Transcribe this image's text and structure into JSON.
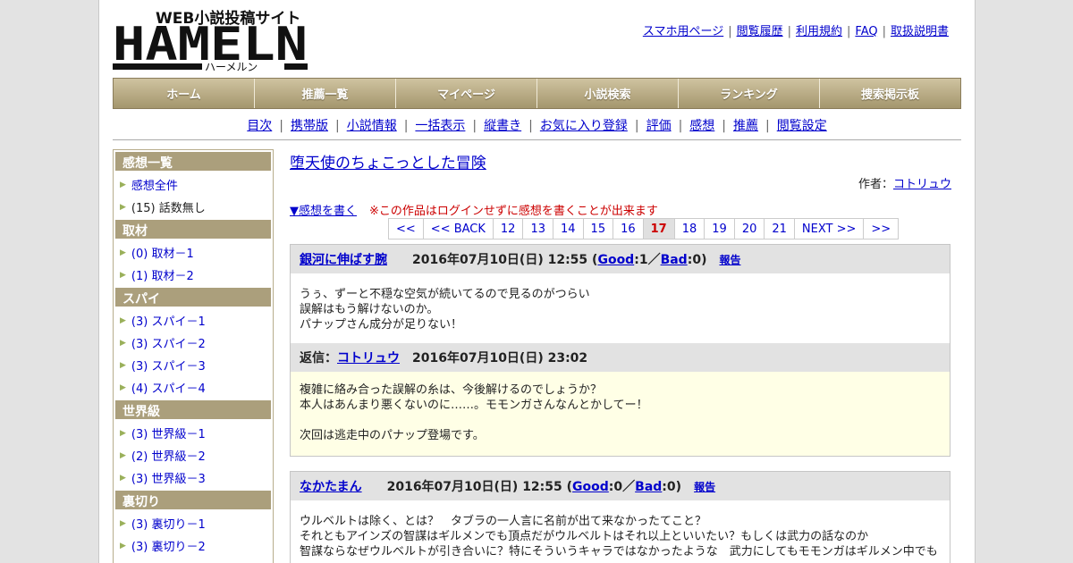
{
  "header": {
    "logo_tagline": "WEB小説投稿サイト",
    "logo_text": "HAMELN",
    "logo_kana": "ハーメルン",
    "toplinks": [
      "スマホ用ページ",
      "閲覧履歴",
      "利用規約",
      "FAQ",
      "取扱説明書"
    ]
  },
  "mainnav": [
    "ホーム",
    "推薦一覧",
    "マイページ",
    "小説検索",
    "ランキング",
    "捜索掲示板"
  ],
  "subnav": [
    "目次",
    "携帯版",
    "小説情報",
    "一括表示",
    "縦書き",
    "お気に入り登録",
    "評価",
    "感想",
    "推薦",
    "閲覧設定"
  ],
  "sidebar": {
    "sections": [
      {
        "title": "感想一覧",
        "items": [
          {
            "label": "感想全件",
            "link": true
          },
          {
            "label": "(15) 話数無し",
            "link": false
          }
        ]
      },
      {
        "title": "取材",
        "items": [
          {
            "label": "(0) 取材－1",
            "link": true
          },
          {
            "label": "(1) 取材－2",
            "link": true
          }
        ]
      },
      {
        "title": "スパイ",
        "items": [
          {
            "label": "(3) スパイ－1",
            "link": true
          },
          {
            "label": "(3) スパイ－2",
            "link": true
          },
          {
            "label": "(3) スパイ－3",
            "link": true
          },
          {
            "label": "(4) スパイ－4",
            "link": true
          }
        ]
      },
      {
        "title": "世界級",
        "items": [
          {
            "label": "(3) 世界級－1",
            "link": true
          },
          {
            "label": "(2) 世界級－2",
            "link": true
          },
          {
            "label": "(3) 世界級－3",
            "link": true
          }
        ]
      },
      {
        "title": "裏切り",
        "items": [
          {
            "label": "(3) 裏切り－1",
            "link": true
          },
          {
            "label": "(3) 裏切り－2",
            "link": true
          }
        ]
      }
    ]
  },
  "novel": {
    "title": "堕天使のちょこっとした冒険",
    "author_label": "作者：",
    "author": "コトリュウ",
    "write_review": "▼感想を書く",
    "login_note": "※この作品はログインせずに感想を書くことが出来ます"
  },
  "pager": {
    "items": [
      "<<",
      "<< BACK",
      "12",
      "13",
      "14",
      "15",
      "16",
      "17",
      "18",
      "19",
      "20",
      "21",
      "NEXT >>",
      ">>"
    ],
    "current": "17"
  },
  "reviews": [
    {
      "user": "銀河に伸ばす腕",
      "date": "2016年07月10日(日) 12:55",
      "good_label": "Good",
      "good": "1",
      "bad_label": "Bad",
      "bad": "0",
      "report": "報告",
      "body": "うぅ、ずーと不穏な空気が続いてるので見るのがつらい\n誤解はもう解けないのか。\nパナップさん成分が足りない！",
      "reply": {
        "label": "返信：",
        "user": "コトリュウ",
        "date": "2016年07月10日(日) 23:02",
        "body": "複雑に絡み合った誤解の糸は、今後解けるのでしょうか？\n本人はあんまり悪くないのに……。モモンガさんなんとかしてー！\n\n次回は逃走中のパナップ登場です。"
      }
    },
    {
      "user": "なかたまん",
      "date": "2016年07月10日(日) 12:55",
      "good_label": "Good",
      "good": "0",
      "bad_label": "Bad",
      "bad": "0",
      "report": "報告",
      "body": "ウルベルトは除く、とは？　タブラの一人言に名前が出て来なかったてこと？\nそれともアインズの智謀はギルメンでも頂点だがウルベルトはそれ以上といいたい？もしくは武力の話なのか\n智謀ならなぜウルベルトが引き合いに？特にそういうキャラではなかったような　武力にしてもモモンガはギルメン中でも"
    }
  ]
}
